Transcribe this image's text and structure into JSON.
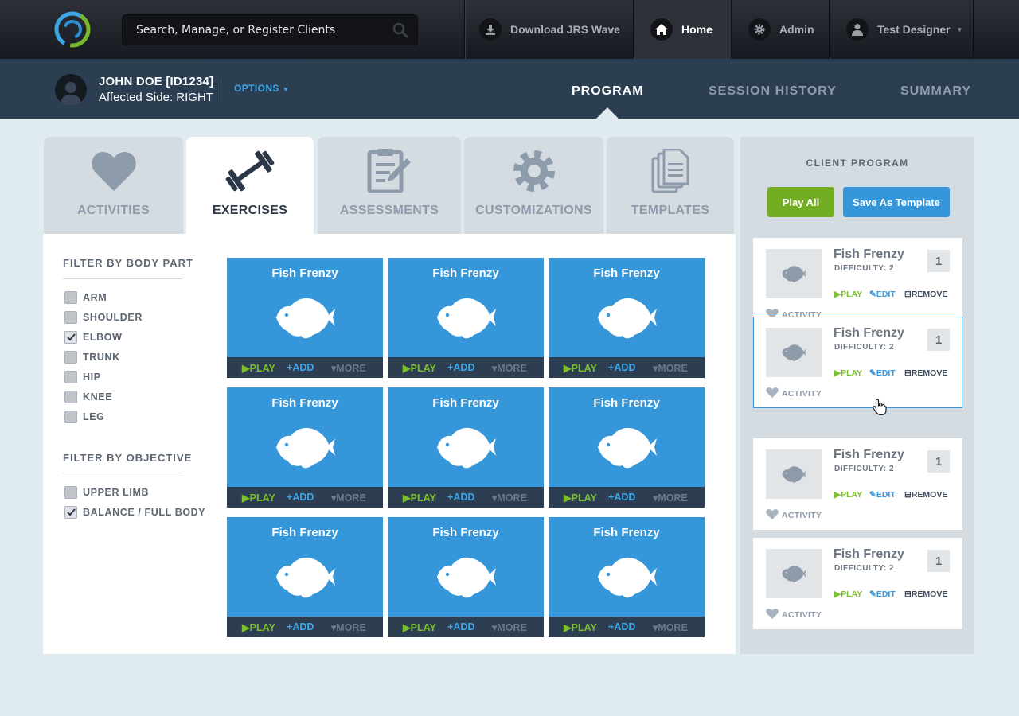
{
  "topbar": {
    "search_placeholder": "Search, Manage, or Register Clients",
    "nav": {
      "download": "Download JRS Wave",
      "home": "Home",
      "admin": "Admin",
      "user": "Test Designer"
    }
  },
  "client": {
    "name": "JOHN DOE [ID1234]",
    "affected_side": "Affected Side: RIGHT",
    "options_label": "OPTIONS"
  },
  "program_tabs": {
    "program": "PROGRAM",
    "session_history": "SESSION HISTORY",
    "summary": "SUMMARY"
  },
  "category_tabs": {
    "activities": "ACTIVITIES",
    "exercises": "EXERCISES",
    "assessments": "ASSESSMENTS",
    "customizations": "CUSTOMIZATIONS",
    "templates": "TEMPLATES"
  },
  "filters": {
    "body_part_title": "FILTER BY BODY PART",
    "body_parts": [
      {
        "label": "ARM",
        "checked": false
      },
      {
        "label": "SHOULDER",
        "checked": false
      },
      {
        "label": "ELBOW",
        "checked": true
      },
      {
        "label": "TRUNK",
        "checked": false
      },
      {
        "label": "HIP",
        "checked": false
      },
      {
        "label": "KNEE",
        "checked": false
      },
      {
        "label": "LEG",
        "checked": false
      }
    ],
    "objective_title": "FILTER BY OBJECTIVE",
    "objectives": [
      {
        "label": "UPPER LIMB",
        "checked": false
      },
      {
        "label": "BALANCE / FULL BODY",
        "checked": true
      }
    ]
  },
  "cards": [
    {
      "title": "Fish Frenzy",
      "play": "PLAY",
      "add": "ADD",
      "more": "MORE"
    },
    {
      "title": "Fish Frenzy",
      "play": "PLAY",
      "add": "ADD",
      "more": "MORE"
    },
    {
      "title": "Fish Frenzy",
      "play": "PLAY",
      "add": "ADD",
      "more": "MORE"
    },
    {
      "title": "Fish Frenzy",
      "play": "PLAY",
      "add": "ADD",
      "more": "MORE"
    },
    {
      "title": "Fish Frenzy",
      "play": "PLAY",
      "add": "ADD",
      "more": "MORE"
    },
    {
      "title": "Fish Frenzy",
      "play": "PLAY",
      "add": "ADD",
      "more": "MORE"
    },
    {
      "title": "Fish Frenzy",
      "play": "PLAY",
      "add": "ADD",
      "more": "MORE"
    },
    {
      "title": "Fish Frenzy",
      "play": "PLAY",
      "add": "ADD",
      "more": "MORE"
    },
    {
      "title": "Fish Frenzy",
      "play": "PLAY",
      "add": "ADD",
      "more": "MORE"
    }
  ],
  "program": {
    "title": "CLIENT PROGRAM",
    "play_all": "Play All",
    "save_template": "Save As Template",
    "items": [
      {
        "title": "Fish Frenzy",
        "difficulty": "DIFFICULTY: 2",
        "count": "1",
        "play": "PLAY",
        "edit": "EDIT",
        "remove": "REMOVE",
        "type": "ACTIVITY"
      },
      {
        "title": "Fish Frenzy",
        "difficulty": "DIFFICULTY: 2",
        "count": "1",
        "play": "PLAY",
        "edit": "EDIT",
        "remove": "REMOVE",
        "type": "ACTIVITY"
      },
      {
        "title": "Fish Frenzy",
        "difficulty": "DIFFICULTY: 2",
        "count": "1",
        "play": "PLAY",
        "edit": "EDIT",
        "remove": "REMOVE",
        "type": "ACTIVITY"
      },
      {
        "title": "Fish Frenzy",
        "difficulty": "DIFFICULTY: 2",
        "count": "1",
        "play": "PLAY",
        "edit": "EDIT",
        "remove": "REMOVE",
        "type": "ACTIVITY"
      }
    ]
  },
  "colors": {
    "accent_blue": "#3597d9",
    "accent_green": "#73ad21",
    "header_dark": "#2c3e52"
  },
  "icons": {
    "logo": "swirl-logo",
    "search": "search-icon",
    "download": "download-icon",
    "home": "home-icon",
    "admin": "gear-icon",
    "user": "user-icon",
    "activities": "heart-icon",
    "exercises": "dumbbell-icon",
    "assessments": "clipboard-icon",
    "customizations": "gear-icon",
    "templates": "documents-icon",
    "card_image": "fish-icon"
  }
}
